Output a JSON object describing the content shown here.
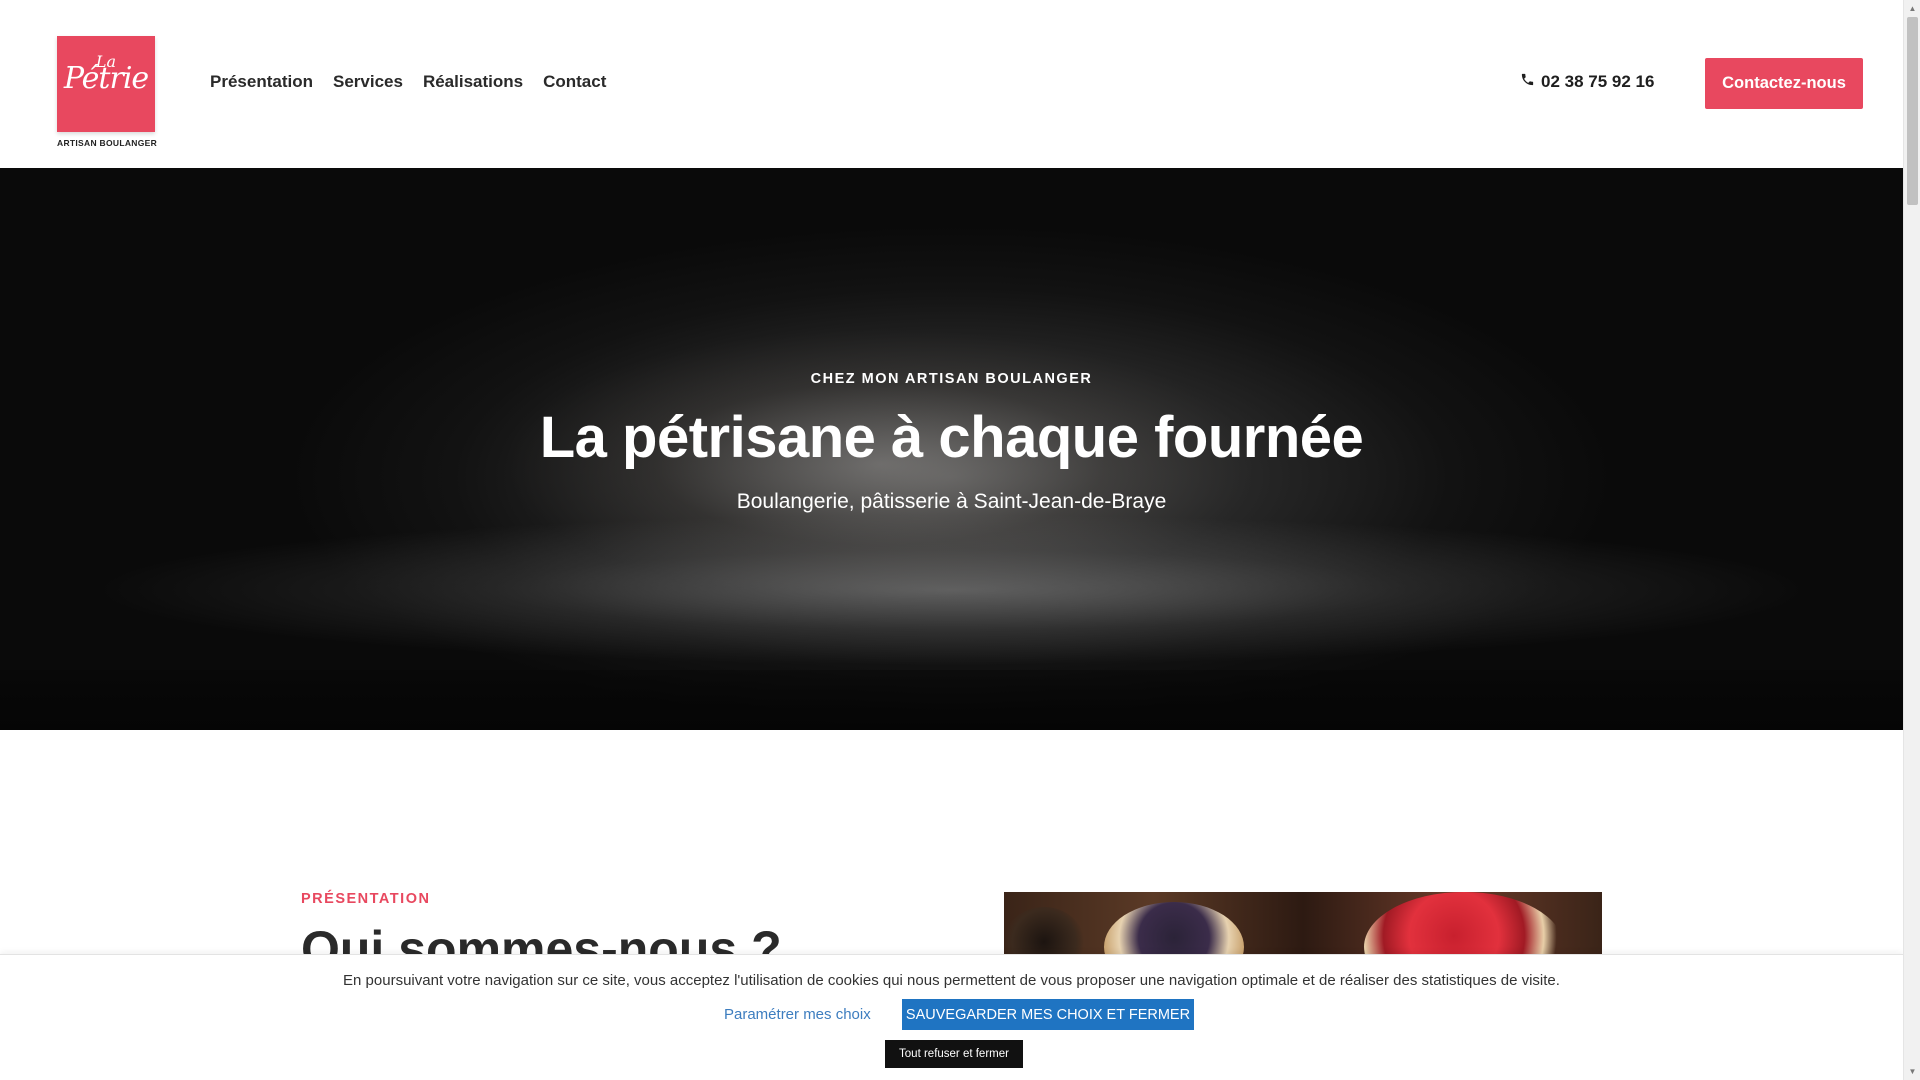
{
  "logo": {
    "top": "La",
    "main": "Pétrie",
    "subtitle": "ARTISAN BOULANGER"
  },
  "nav": {
    "items": [
      {
        "label": "Présentation"
      },
      {
        "label": "Services"
      },
      {
        "label": "Réalisations"
      },
      {
        "label": "Contact"
      }
    ]
  },
  "header": {
    "phone": "02 38 75 92 16",
    "cta_label": "Contactez-nous"
  },
  "hero": {
    "kicker": "CHEZ MON ARTISAN BOULANGER",
    "title": "La pétrisane à chaque fournée",
    "subtitle": "Boulangerie, pâtisserie à Saint-Jean-de-Braye"
  },
  "presentation": {
    "kicker": "PRÉSENTATION",
    "title": "Qui sommes-nous ?"
  },
  "cookie": {
    "message": "En poursuivant votre navigation sur ce site, vous acceptez l'utilisation de cookies qui nous permettent de vous proposer une navigation optimale et de réaliser des statistiques de visite.",
    "settings_label": "Paramétrer mes choix",
    "save_label": "SAUVEGARDER MES CHOIX ET FERMER",
    "refuse_label": "Tout refuser et fermer"
  },
  "colors": {
    "brand": "#e8485f",
    "cookie_button": "#1f74c2",
    "link": "#3d7dbf"
  },
  "icons": {
    "phone": "phone-icon"
  }
}
